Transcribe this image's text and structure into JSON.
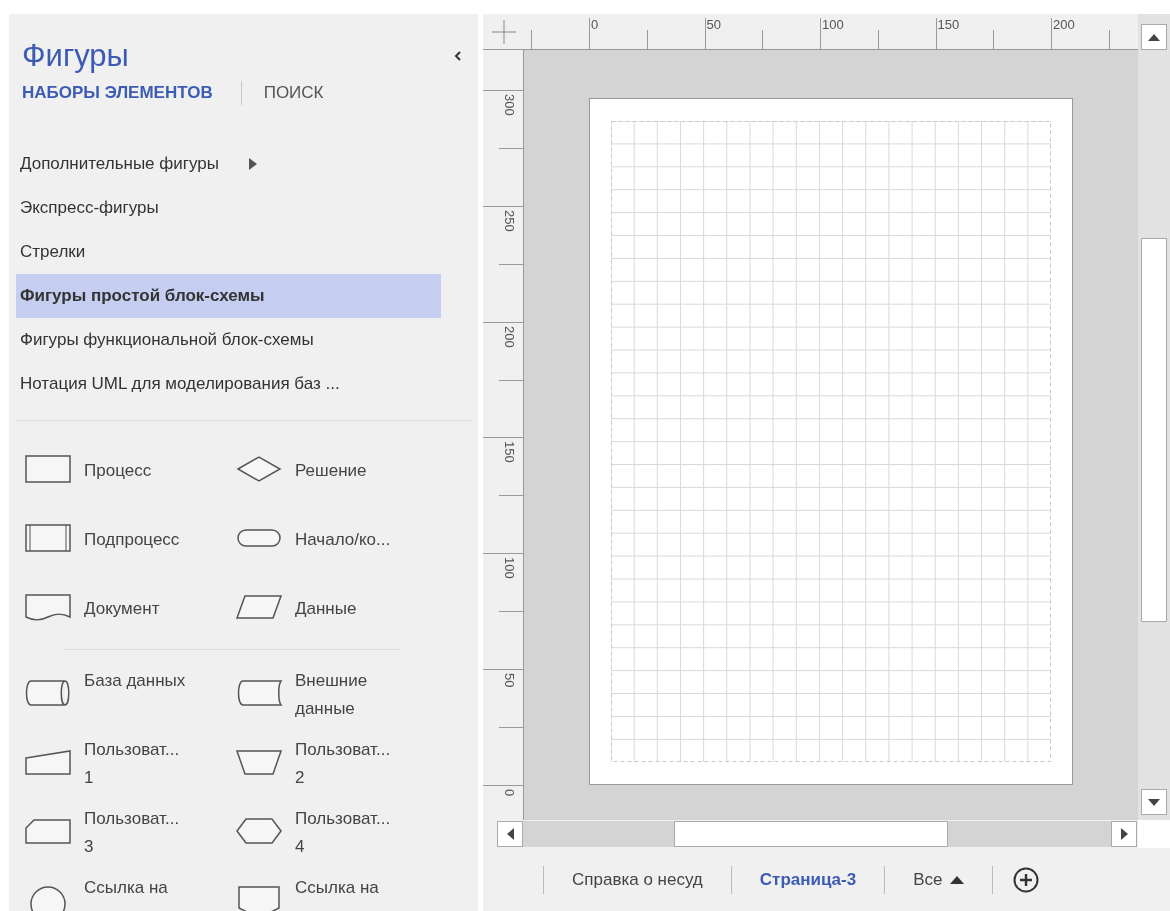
{
  "panel": {
    "title": "Фигуры",
    "tabs": [
      {
        "label": "НАБОРЫ ЭЛЕМЕНТОВ",
        "selected": true
      },
      {
        "label": "ПОИСК",
        "selected": false
      }
    ],
    "stencils": [
      {
        "label": "Дополнительные фигуры",
        "kind": "submenu",
        "selected": false
      },
      {
        "label": "Экспресс-фигуры",
        "kind": "plain",
        "selected": false
      },
      {
        "label": "Стрелки",
        "kind": "plain",
        "selected": false
      },
      {
        "label": "Фигуры простой блок-схемы",
        "kind": "plain",
        "selected": true
      },
      {
        "label": "Фигуры функциональной блок-схемы",
        "kind": "plain",
        "selected": false
      },
      {
        "label": "Нотация UML для моделирования баз ...",
        "kind": "plain",
        "selected": false
      }
    ],
    "shape_groups": [
      [
        {
          "label": "Процесс",
          "kind": "process"
        },
        {
          "label": "Решение",
          "kind": "decision"
        },
        {
          "label": "Подпроцесс",
          "kind": "subprocess"
        },
        {
          "label": "Начало/ко...",
          "kind": "terminator"
        },
        {
          "label": "Документ",
          "kind": "document"
        },
        {
          "label": "Данные",
          "kind": "data"
        }
      ],
      [
        {
          "label": "База данных",
          "kind": "database"
        },
        {
          "label": "Внешние\nданные",
          "kind": "external"
        },
        {
          "label": "Пользоват...\n1",
          "kind": "manual-input"
        },
        {
          "label": "Пользоват...\n2",
          "kind": "trapezoid"
        },
        {
          "label": "Пользоват...\n3",
          "kind": "card"
        },
        {
          "label": "Пользоват...\n4",
          "kind": "hexagon"
        },
        {
          "label": "Ссылка на",
          "kind": "circle"
        },
        {
          "label": "Ссылка на",
          "kind": "offpage"
        }
      ]
    ]
  },
  "rulers": {
    "horizontal": [
      "0",
      "50",
      "100",
      "150",
      "200"
    ],
    "vertical": [
      "300",
      "250",
      "200",
      "150",
      "100",
      "50",
      "0"
    ]
  },
  "page_tabs": [
    {
      "label": "Справка о несуд",
      "kind": "page",
      "selected": false
    },
    {
      "label": "Страница-3",
      "kind": "page",
      "selected": true
    },
    {
      "label": "Все",
      "kind": "menu",
      "selected": false
    }
  ]
}
